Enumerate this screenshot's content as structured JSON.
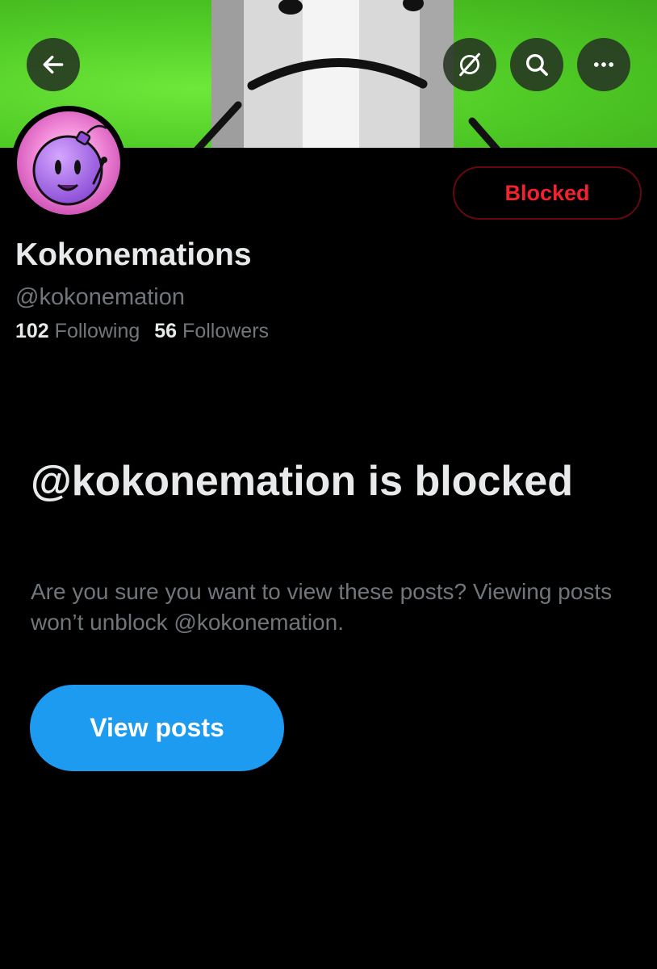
{
  "header": {
    "icons": {
      "back": "back-arrow-icon",
      "grok": "grok-slash-circle-icon",
      "search": "search-icon",
      "more": "more-horizontal-icon"
    }
  },
  "profile": {
    "display_name": "Kokonemations",
    "handle": "@kokonemation",
    "following_count": "102",
    "following_label": "Following",
    "followers_count": "56",
    "followers_label": "Followers",
    "blocked_label": "Blocked"
  },
  "blocked_notice": {
    "heading": "@kokonemation is blocked",
    "description": "Are you sure you want to view these posts? Viewing posts won’t unblock @kokonemation.",
    "button_label": "View posts"
  },
  "colors": {
    "background": "#000000",
    "primary_text": "#e7e9ea",
    "secondary_text": "#71767b",
    "blocked_red": "#f4212e",
    "accent_blue": "#1d9bf0",
    "banner_green": "#4ec925"
  }
}
